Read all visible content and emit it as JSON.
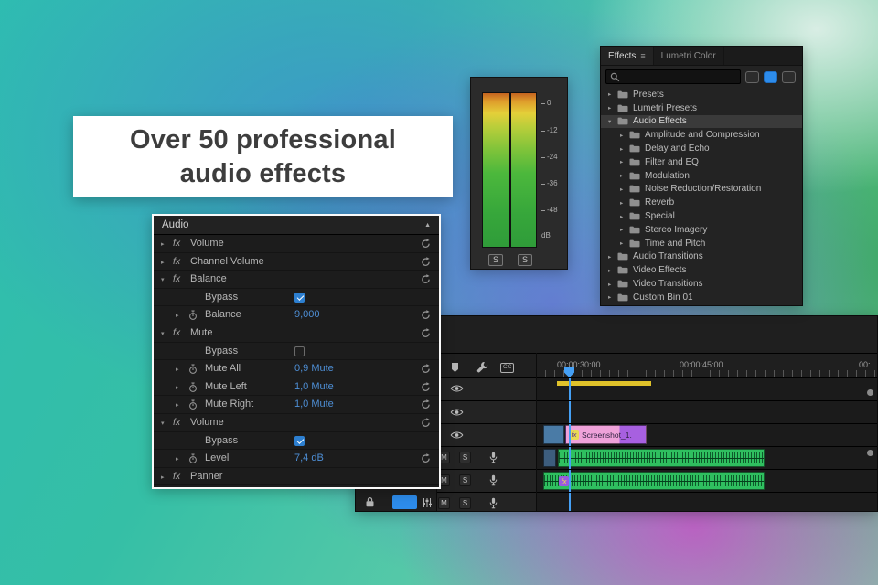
{
  "banner": {
    "line1": "Over 50 professional",
    "line2": "audio effects"
  },
  "effect_controls": {
    "header": "Audio",
    "fx_icon": "fx",
    "rows": [
      {
        "kind": "effect",
        "label": "Volume",
        "expanded": false,
        "reset": true
      },
      {
        "kind": "effect",
        "label": "Channel Volume",
        "expanded": false,
        "reset": true
      },
      {
        "kind": "effect",
        "label": "Balance",
        "expanded": true,
        "reset": true
      },
      {
        "kind": "bypass",
        "label": "Bypass",
        "checked": true
      },
      {
        "kind": "property",
        "label": "Balance",
        "value": "9,000",
        "reset": true
      },
      {
        "kind": "effect",
        "label": "Mute",
        "expanded": true,
        "reset": true
      },
      {
        "kind": "bypass",
        "label": "Bypass",
        "checked": false
      },
      {
        "kind": "property",
        "label": "Mute All",
        "value": "0,9 Mute",
        "reset": true
      },
      {
        "kind": "property",
        "label": "Mute Left",
        "value": "1,0 Mute",
        "reset": true
      },
      {
        "kind": "property",
        "label": "Mute Right",
        "value": "1,0 Mute",
        "reset": true
      },
      {
        "kind": "effect",
        "label": "Volume",
        "expanded": true,
        "reset": true
      },
      {
        "kind": "bypass",
        "label": "Bypass",
        "checked": true
      },
      {
        "kind": "property",
        "label": "Level",
        "value": "7,4 dB",
        "reset": true
      },
      {
        "kind": "effect",
        "label": "Panner",
        "expanded": false,
        "reset": false
      }
    ]
  },
  "audio_meter": {
    "scale_labels": [
      "0",
      "-12",
      "-24",
      "-36",
      "-48",
      "dB"
    ],
    "solo_buttons": [
      "S",
      "S"
    ]
  },
  "effects_panel": {
    "tabs": [
      {
        "label": "Effects",
        "active": true
      },
      {
        "label": "Lumetri Color",
        "active": false
      }
    ],
    "tree": [
      {
        "label": "Presets",
        "depth": 0,
        "expanded": false,
        "selected": false
      },
      {
        "label": "Lumetri Presets",
        "depth": 0,
        "expanded": false,
        "selected": false
      },
      {
        "label": "Audio Effects",
        "depth": 0,
        "expanded": true,
        "selected": true
      },
      {
        "label": "Amplitude and Compression",
        "depth": 1,
        "expanded": false,
        "selected": false
      },
      {
        "label": "Delay and Echo",
        "depth": 1,
        "expanded": false,
        "selected": false
      },
      {
        "label": "Filter and EQ",
        "depth": 1,
        "expanded": false,
        "selected": false
      },
      {
        "label": "Modulation",
        "depth": 1,
        "expanded": false,
        "selected": false
      },
      {
        "label": "Noise Reduction/Restoration",
        "depth": 1,
        "expanded": false,
        "selected": false
      },
      {
        "label": "Reverb",
        "depth": 1,
        "expanded": false,
        "selected": false
      },
      {
        "label": "Special",
        "depth": 1,
        "expanded": false,
        "selected": false
      },
      {
        "label": "Stereo Imagery",
        "depth": 1,
        "expanded": false,
        "selected": false
      },
      {
        "label": "Time and Pitch",
        "depth": 1,
        "expanded": false,
        "selected": false
      },
      {
        "label": "Audio Transitions",
        "depth": 0,
        "expanded": false,
        "selected": false
      },
      {
        "label": "Video Effects",
        "depth": 0,
        "expanded": false,
        "selected": false
      },
      {
        "label": "Video Transitions",
        "depth": 0,
        "expanded": false,
        "selected": false
      },
      {
        "label": "Custom Bin 01",
        "depth": 0,
        "expanded": false,
        "selected": false
      }
    ]
  },
  "timeline": {
    "ruler_labels": [
      "00:00:30:00",
      "00:00:45:00",
      "00:"
    ],
    "cc_badge": "CC",
    "track_buttons": {
      "mute": "M",
      "solo": "S"
    },
    "video_clip": {
      "name": "Screenshot_1.",
      "fx_badge": "fx"
    },
    "audio_fx_badge": "fx"
  },
  "icons": {
    "search": "magnifier",
    "panel_menu": "≡",
    "collapse": "▲",
    "chevron_collapsed": "▸",
    "chevron_expanded": "▾"
  },
  "colors": {
    "accent_blue": "#2d8ceb",
    "value_blue": "#4e8fd6",
    "checkbox_blue": "#2d7fd0",
    "clip_pink": "#efa2da",
    "clip_purple": "#a760e0",
    "clip_green": "#2fbf5f",
    "clip_steel_blue": "#4a7ba6",
    "work_bar_yellow": "#e0c22a",
    "panel_bg": "#232323"
  }
}
